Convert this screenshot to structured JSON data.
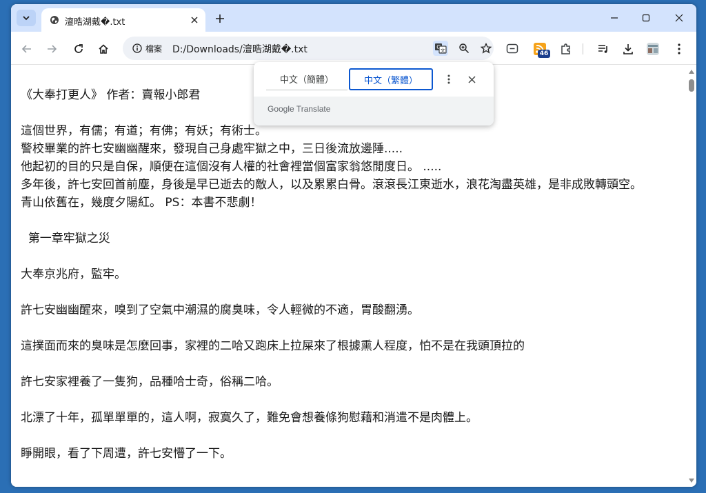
{
  "tab": {
    "title": "澶晧湖戴�.txt",
    "favicon": "globe-icon"
  },
  "toolbar": {
    "site_chip_label": "檔案",
    "url": "D:/Downloads/澶晧湖戴�.txt",
    "extension_badge": "46"
  },
  "translate_popup": {
    "languages": [
      "中文（簡體）",
      "中文（繁體）"
    ],
    "selected": "中文（繁體）",
    "powered_by": "Google Translate"
  },
  "document": {
    "lines": [
      "《大奉打更人》 作者：賣報小郎君",
      "",
      "這個世界，有儒；有道；有佛；有妖；有術士。",
      "警校畢業的許七安幽幽醒來，發現自己身處牢獄之中，三日後流放邊陲.....",
      "他起初的目的只是自保，順便在這個沒有人權的社會裡當個富家翁悠閒度日。 .....",
      "多年後，許七安回首前塵，身後是早已逝去的敵人，以及累累白骨。滾滾長江東逝水，浪花淘盡英雄，是非成敗轉頭空。",
      "青山依舊在，幾度夕陽紅。 PS：本書不悲劇！",
      "",
      "  第一章牢獄之災",
      "",
      "大奉京兆府，監牢。",
      "",
      "許七安幽幽醒來，嗅到了空氣中潮濕的腐臭味，令人輕微的不適，胃酸翻湧。",
      "",
      "這撲面而來的臭味是怎麼回事，家裡的二哈又跑床上拉屎來了根據熏人程度，怕不是在我頭頂拉的",
      "",
      "許七安家裡養了一隻狗，品種哈士奇，俗稱二哈。",
      "",
      "北漂了十年，孤單單單的，這人啊，寂寞久了，難免會想養條狗慰藉和消遣不是肉體上。",
      "",
      "睜開眼，看了下周遭，許七安懵了一下。"
    ]
  },
  "colors": {
    "accent": "#0b57d0",
    "tabstrip": "#d3e3fd",
    "desktop": "#2b6fb5"
  }
}
